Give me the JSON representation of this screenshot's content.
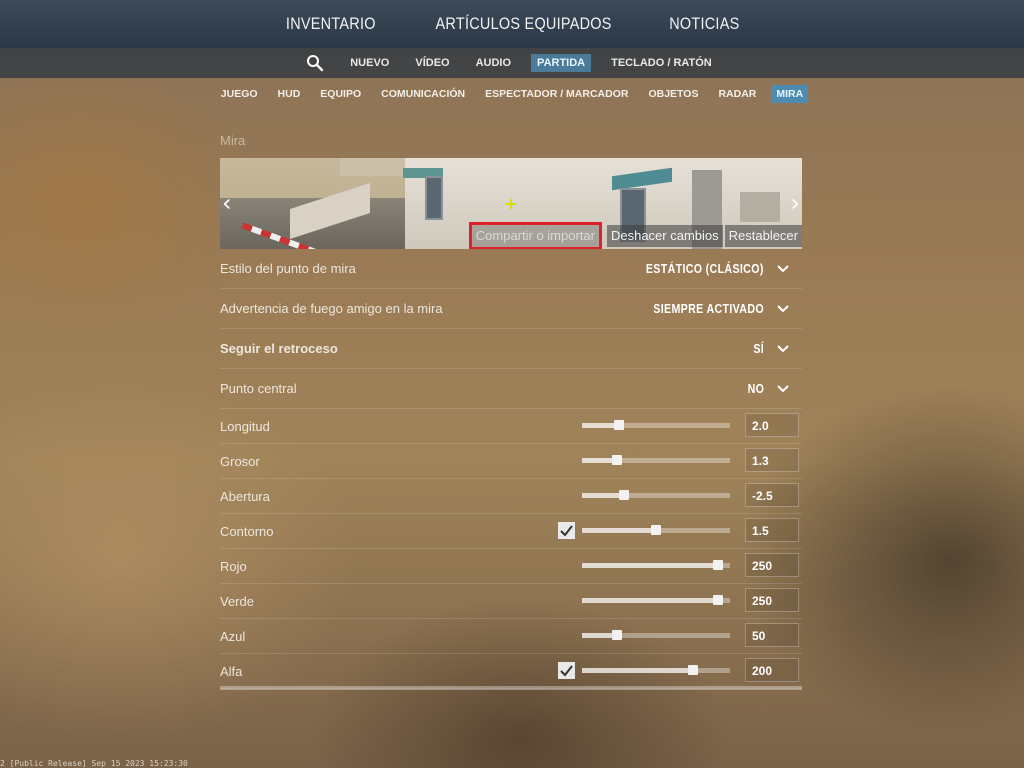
{
  "top_nav": {
    "items": [
      "INVENTARIO",
      "ARTÍCULOS EQUIPADOS",
      "NOTICIAS"
    ]
  },
  "sub_nav": {
    "search_icon": "search-icon",
    "items": [
      {
        "label": "NUEVO",
        "active": false
      },
      {
        "label": "VÍDEO",
        "active": false
      },
      {
        "label": "AUDIO",
        "active": false
      },
      {
        "label": "PARTIDA",
        "active": true
      },
      {
        "label": "TECLADO / RATÓN",
        "active": false
      }
    ]
  },
  "game_tabs": [
    {
      "label": "JUEGO",
      "active": false
    },
    {
      "label": "HUD",
      "active": false
    },
    {
      "label": "EQUIPO",
      "active": false
    },
    {
      "label": "COMUNICACIÓN",
      "active": false
    },
    {
      "label": "ESPECTADOR / MARCADOR",
      "active": false
    },
    {
      "label": "OBJETOS",
      "active": false
    },
    {
      "label": "RADAR",
      "active": false
    },
    {
      "label": "MIRA",
      "active": true
    }
  ],
  "section": {
    "title": "Mira"
  },
  "preview": {
    "actions": {
      "share": "Compartir o importar",
      "undo": "Deshacer cambios",
      "reset": "Restablecer"
    }
  },
  "dropdowns": [
    {
      "label": "Estilo del punto de mira",
      "value": "ESTÁTICO (CLÁSICO)",
      "bold": false
    },
    {
      "label": "Advertencia de fuego amigo en la mira",
      "value": "SIEMPRE ACTIVADO",
      "bold": false
    },
    {
      "label": "Seguir el retroceso",
      "value": "SÍ",
      "bold": true
    },
    {
      "label": "Punto central",
      "value": "NO",
      "bold": false
    }
  ],
  "sliders": [
    {
      "label": "Longitud",
      "value": "2.0",
      "fraction": 0.23,
      "checkbox": false
    },
    {
      "label": "Grosor",
      "value": "1.3",
      "fraction": 0.22,
      "checkbox": false
    },
    {
      "label": "Abertura",
      "value": "-2.5",
      "fraction": 0.27,
      "checkbox": false
    },
    {
      "label": "Contorno",
      "value": "1.5",
      "fraction": 0.5,
      "checkbox": true
    },
    {
      "label": "Rojo",
      "value": "250",
      "fraction": 0.95,
      "checkbox": false
    },
    {
      "label": "Verde",
      "value": "250",
      "fraction": 0.95,
      "checkbox": false
    },
    {
      "label": "Azul",
      "value": "50",
      "fraction": 0.22,
      "checkbox": false
    },
    {
      "label": "Alfa",
      "value": "200",
      "fraction": 0.77,
      "checkbox": true
    }
  ],
  "build_info": "2 [Public Release] Sep 15 2023 15:23:30",
  "colors": {
    "active_tab": "#4d8bb0",
    "highlight": "#e0202a"
  }
}
